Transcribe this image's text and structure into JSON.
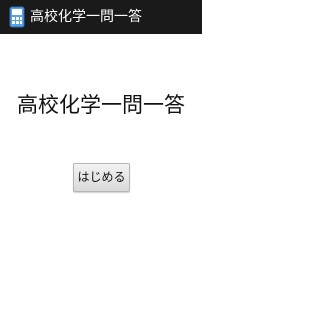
{
  "window": {
    "title": "高校化学一問一答",
    "icon": "app-icon"
  },
  "main": {
    "heading": "高校化学一問一答",
    "start_button_label": "はじめる"
  },
  "colors": {
    "titlebar_bg": "#1a1a1a",
    "titlebar_text": "#ffffff",
    "page_bg": "#ffffff",
    "button_bg": "#e5e5e5"
  }
}
